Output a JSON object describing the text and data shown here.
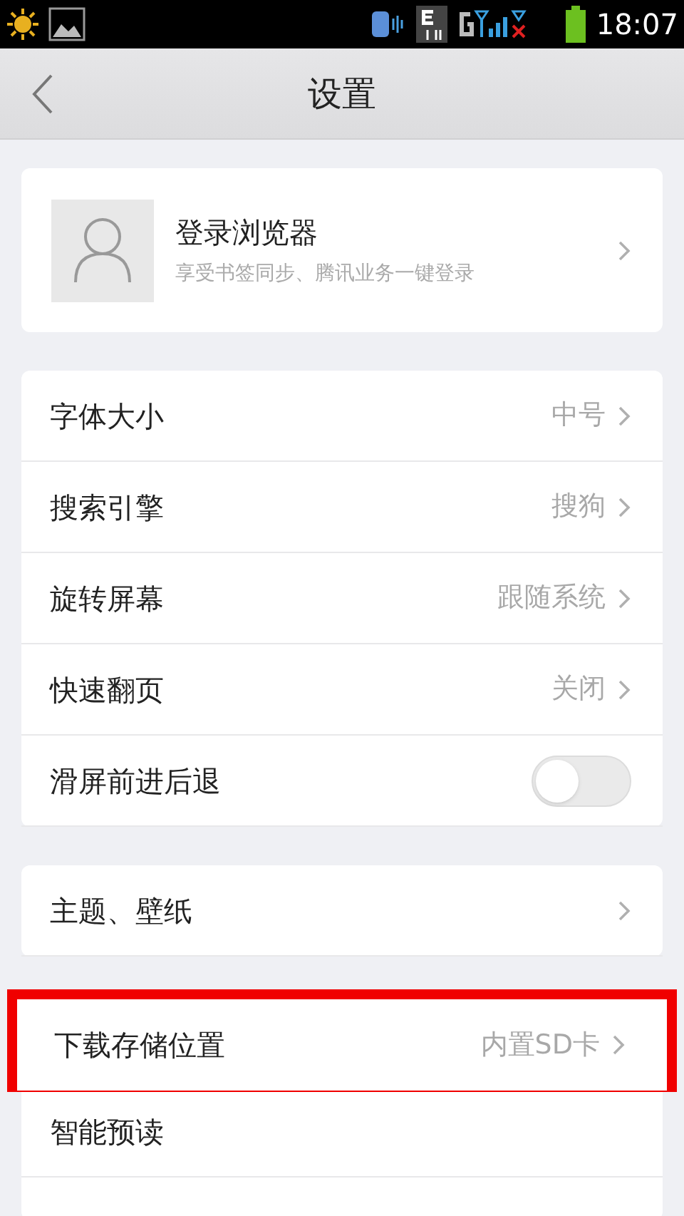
{
  "status_bar": {
    "time": "18:07"
  },
  "header": {
    "title": "设置"
  },
  "account": {
    "title": "登录浏览器",
    "subtitle": "享受书签同步、腾讯业务一键登录"
  },
  "groups": [
    {
      "items": [
        {
          "kind": "link",
          "label": "字体大小",
          "value": "中号",
          "highlighted": false
        },
        {
          "kind": "link",
          "label": "搜索引擎",
          "value": "搜狗",
          "highlighted": false
        },
        {
          "kind": "link",
          "label": "旋转屏幕",
          "value": "跟随系统",
          "highlighted": false
        },
        {
          "kind": "link",
          "label": "快速翻页",
          "value": "关闭",
          "highlighted": false
        },
        {
          "kind": "toggle",
          "label": "滑屏前进后退",
          "on": false,
          "highlighted": false
        }
      ]
    },
    {
      "items": [
        {
          "kind": "link",
          "label": "主题、壁纸",
          "highlighted": false
        }
      ]
    },
    {
      "items": [
        {
          "kind": "link",
          "label": "下载存储位置",
          "value": "内置SD卡",
          "highlighted": true
        },
        {
          "kind": "plain",
          "label": "智能预读",
          "highlighted": false
        },
        {
          "kind": "blank"
        }
      ]
    }
  ]
}
